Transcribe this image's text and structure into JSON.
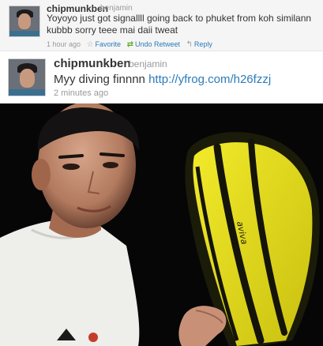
{
  "tweet1": {
    "username": "chipmunkben",
    "realname": "benjamin",
    "text": "Yoyoyo just got signallll going back to phuket from koh similann kubbb sorry teee mai daii tweat",
    "time": "1 hour ago",
    "actions": {
      "favorite": "Favorite",
      "undo_retweet": "Undo Retweet",
      "reply": "Reply"
    }
  },
  "tweet2": {
    "username": "chipmunkben",
    "realname": "benjamin",
    "text": "Myy diving finnnn",
    "link": "http://yfrog.com/h26fzzj",
    "time": "2 minutes ago"
  },
  "photo": {
    "fin_brand": "aviva"
  },
  "colors": {
    "link": "#2b7bb9",
    "fin_yellow": "#e8e21a",
    "retweet_green": "#5fa524"
  }
}
